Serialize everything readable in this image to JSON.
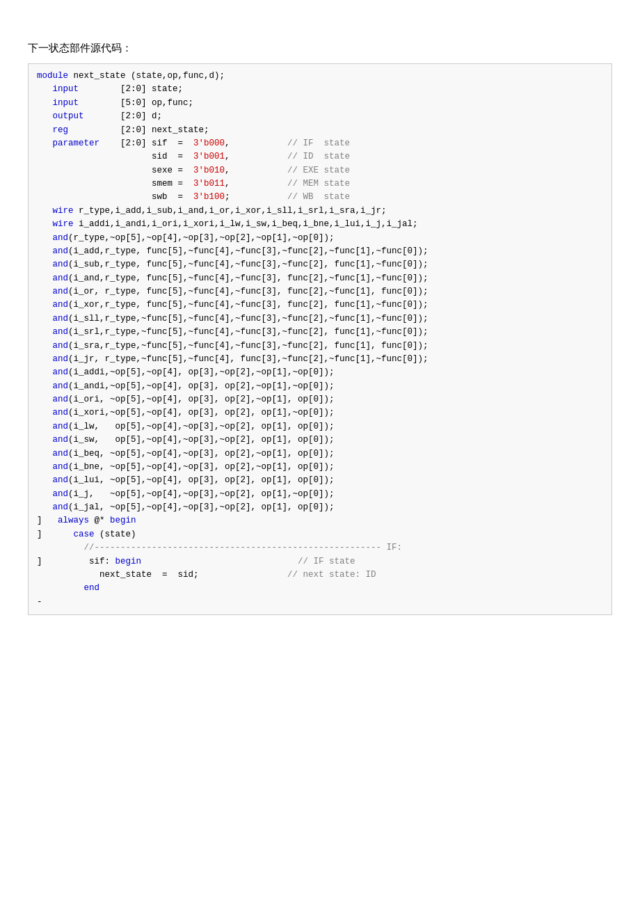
{
  "title": "下一状态部件源代码：",
  "code": {
    "lines": []
  }
}
